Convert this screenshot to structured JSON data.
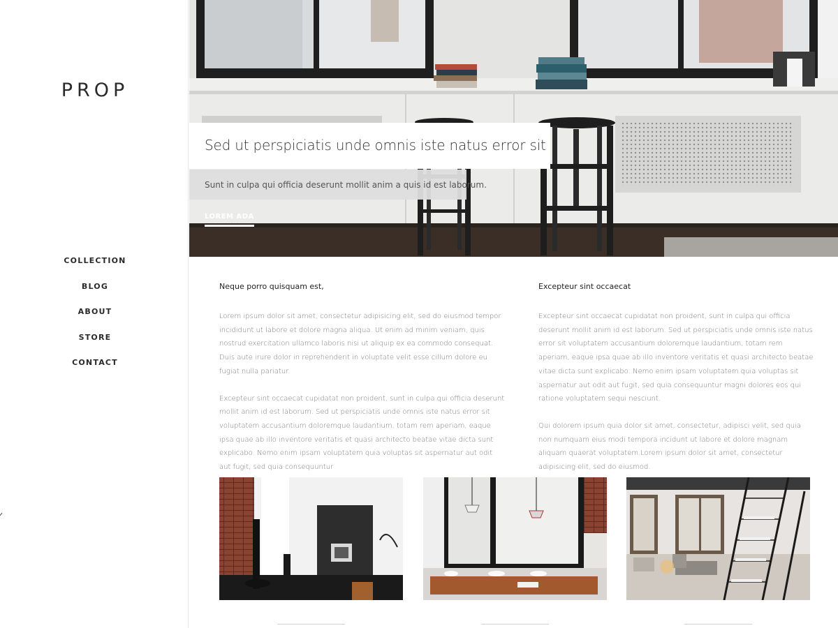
{
  "brand": {
    "name": "PROP"
  },
  "nav": {
    "items": [
      {
        "label": "COLLECTION"
      },
      {
        "label": "BLOG"
      },
      {
        "label": "ABOUT"
      },
      {
        "label": "STORE"
      },
      {
        "label": "CONTACT"
      }
    ]
  },
  "hero": {
    "title": "Sed ut perspiciatis unde omnis iste natus error sit",
    "subtitle": "Sunt in culpa qui officia deserunt mollit anim a quis id est laborum.",
    "cta_label": "LOREM ADA"
  },
  "content": {
    "left": {
      "heading": "Neque porro quisquam est,",
      "paragraphs": [
        "Lorem ipsum dolor sit amet, consectetur adipisicing elit, sed do eiusmod tempor incididunt ut labore et dolore magna aliqua. Ut enim ad minim veniam, quis nostrud exercitation ullamco laboris nisi ut aliquip ex ea commodo consequat. Duis aute irure dolor in reprehenderit in voluptate velit esse cillum dolore eu fugiat nulla pariatur.",
        "Excepteur sint occaecat cupidatat non proident, sunt in culpa qui officia deserunt mollit anim id est laborum. Sed ut perspiciatis unde omnis iste natus error sit voluptatem accusantium doloremque laudantium, totam rem aperiam, eaque ipsa quae ab illo inventore veritatis et quasi architecto beatae vitae dicta sunt explicabo. Nemo enim ipsam voluptatem quia voluptas sit aspernatur aut odit aut fugit, sed quia consequuntur"
      ]
    },
    "right": {
      "heading": "Excepteur sint occaecat",
      "paragraphs": [
        "Excepteur sint occaecat cupidatat non proident, sunt in culpa qui officia deserunt mollit anim id est laborum. Sed ut perspiciatis unde omnis iste natus error sit voluptatem accusantium doloremque laudantium, totam rem aperiam, eaque ipsa quae ab illo inventore veritatis et quasi architecto beatae vitae dicta sunt explicabo. Nemo enim ipsam voluptatem quia voluptas sit aspernatur aut odit aut fugit, sed quia consequuntur magni dolores eos qui ratione voluptatem sequi nesciunt.",
        "Qui dolorem ipsum quia dolor sit amet, consectetur, adipisci velit, sed quia non numquam eius modi tempora incidunt ut labore et dolore magnam aliquam quaerat voluptatem.Lorem ipsum dolor sit amet, consectetur adipisicing elit, sed do eiusmod."
      ]
    }
  },
  "colors": {
    "text_dark": "#222222",
    "text_muted": "#777777",
    "sidebar_border": "#e8e8e8",
    "hero_subtitle_bg": "#dedede"
  }
}
